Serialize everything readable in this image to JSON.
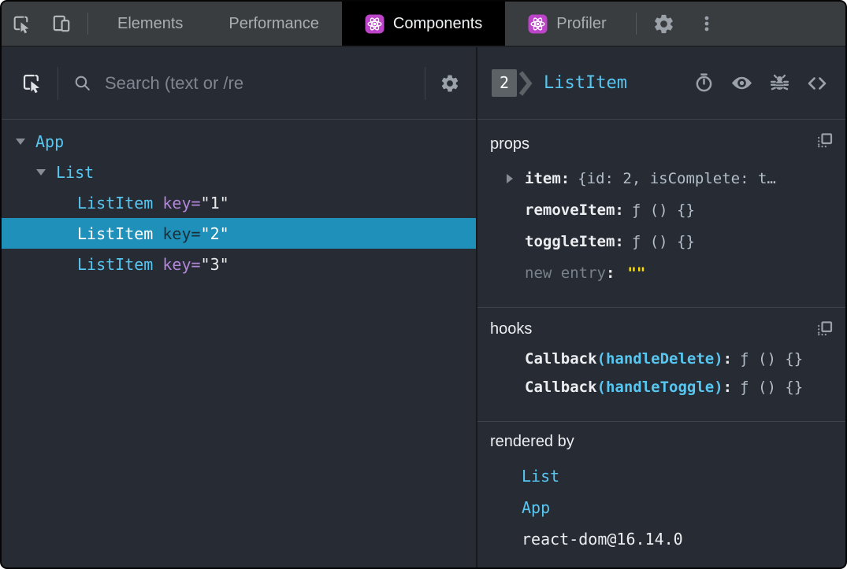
{
  "topbar": {
    "tabs": [
      {
        "label": "Elements",
        "active": false
      },
      {
        "label": "Performance",
        "active": false
      },
      {
        "label": "Components",
        "active": true,
        "icon": "react"
      },
      {
        "label": "Profiler",
        "active": false,
        "icon": "react"
      }
    ]
  },
  "left": {
    "search_placeholder": "Search (text or /re",
    "tree": [
      {
        "label": "App",
        "depth": 0,
        "expanded": true
      },
      {
        "label": "List",
        "depth": 1,
        "expanded": true
      },
      {
        "label": "ListItem",
        "attr": "key=",
        "value": "\"1\"",
        "depth": 2,
        "selected": false
      },
      {
        "label": "ListItem",
        "attr": "key=",
        "value": "\"2\"",
        "depth": 2,
        "selected": true
      },
      {
        "label": "ListItem",
        "attr": "key=",
        "value": "\"3\"",
        "depth": 2,
        "selected": false
      }
    ]
  },
  "right": {
    "header": {
      "badge": "2",
      "component": "ListItem"
    },
    "props": {
      "title": "props",
      "rows": [
        {
          "name": "item",
          "colon": ":",
          "value": "{id: 2, isComplete: t…",
          "expandable": true
        },
        {
          "name": "removeItem",
          "colon": ":",
          "value": "ƒ () {}"
        },
        {
          "name": "toggleItem",
          "colon": ":",
          "value": "ƒ () {}"
        },
        {
          "name": "new entry",
          "colon": ":",
          "value": "\"\"",
          "editable": true
        }
      ]
    },
    "hooks": {
      "title": "hooks",
      "rows": [
        {
          "name": "Callback",
          "paren": "(handleDelete)",
          "colon": ":",
          "value": "ƒ () {}"
        },
        {
          "name": "Callback",
          "paren": "(handleToggle)",
          "colon": ":",
          "value": "ƒ () {}"
        }
      ]
    },
    "rendered_by": {
      "title": "rendered by",
      "rows": [
        {
          "label": "List",
          "link": true
        },
        {
          "label": "App",
          "link": true
        },
        {
          "label": "react-dom@16.14.0",
          "link": false
        }
      ]
    }
  },
  "colors": {
    "component_cyan": "#57c7f2",
    "key_purple": "#b286d8",
    "selection_blue": "#1e90b9",
    "string_yellow": "#ffe100",
    "react_logo_purple": "#bb44c8",
    "panel_background": "#272b33",
    "topbar_background": "#3a3d40",
    "active_tab_background": "#000000"
  }
}
